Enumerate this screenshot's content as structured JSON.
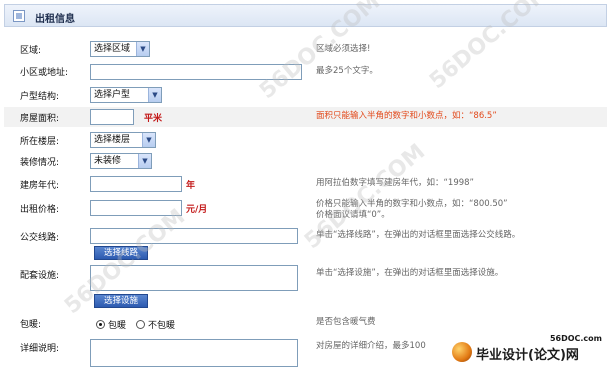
{
  "header": {
    "title": "出租信息"
  },
  "fields": {
    "region": {
      "label": "区域:",
      "select": "选择区域",
      "hint": "区域必须选择!"
    },
    "address": {
      "label": "小区或地址:",
      "value": "",
      "hint": "最多25个文字。"
    },
    "layout": {
      "label": "户型结构:",
      "select": "选择户型"
    },
    "area": {
      "label": "房屋面积:",
      "value": "",
      "unit": "平米",
      "hint": "面积只能输入半角的数字和小数点，如：“86.5”"
    },
    "floor": {
      "label": "所在楼层:",
      "select": "选择楼层"
    },
    "decoration": {
      "label": "装修情况:",
      "select": "未装修"
    },
    "year": {
      "label": "建房年代:",
      "value": "",
      "unit": "年",
      "hint": "用阿拉伯数字填写建房年代，如：“1998”"
    },
    "price": {
      "label": "出租价格:",
      "value": "",
      "unit": "元/月",
      "hint_line1": "价格只能输入半角的数字和小数点，如：“800.50”",
      "hint_line2": "价格面议请填“0”。"
    },
    "bus": {
      "label": "公交线路:",
      "value": "",
      "button": "选择线路",
      "hint": "单击“选择线路”，在弹出的对话框里面选择公交线路。"
    },
    "facilities": {
      "label": "配套设施:",
      "value": "",
      "button": "选择设施",
      "hint": "单击“选择设施”，在弹出的对话框里面选择设施。"
    },
    "heating": {
      "label": "包暖:",
      "option_yes": "包暖",
      "option_no": "不包暖",
      "selected": "包暖",
      "hint": "是否包含暖气费"
    },
    "details": {
      "label": "详细说明:",
      "value": "",
      "hint": "对房屋的详细介绍，最多100"
    }
  },
  "watermark": {
    "text": "56DOC.COM"
  },
  "logo": {
    "url": "56DOC.com",
    "text": "毕业设计(论文)网"
  },
  "colors": {
    "unit_red": "#c31a1a",
    "hint_orange": "#e2491b",
    "button_blue": "#2c5ab0"
  }
}
